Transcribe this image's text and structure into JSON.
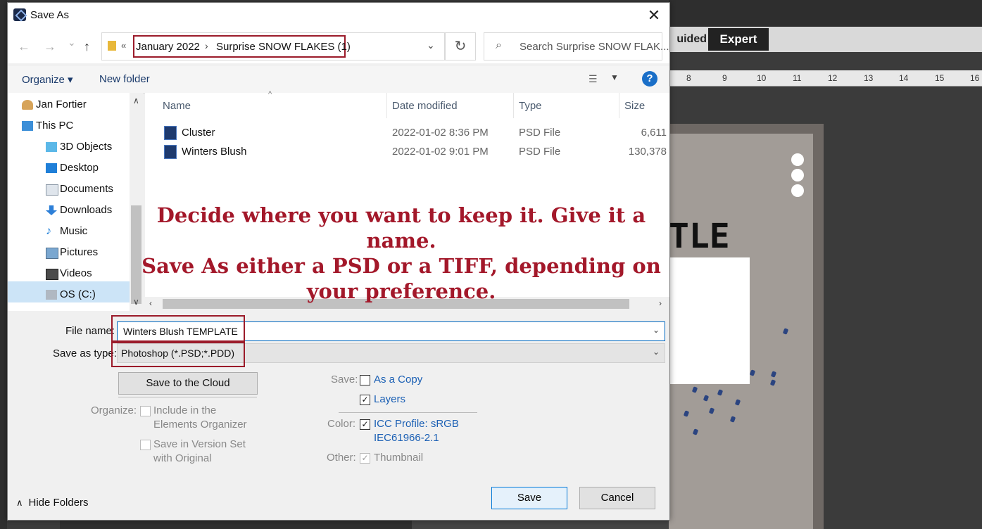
{
  "background_app": {
    "mode_guided": "uided",
    "mode_expert": "Expert",
    "ruler_ticks": [
      "8",
      "9",
      "10",
      "11",
      "12",
      "13",
      "14",
      "15",
      "16"
    ],
    "canvas_title": "TLE"
  },
  "dialog": {
    "title": "Save As",
    "close_symbol": "✕"
  },
  "navigation": {
    "back_symbol": "←",
    "forward_symbol": "→",
    "recent_symbol": "⌄",
    "up_symbol": "↑",
    "chevron": "«",
    "breadcrumb": [
      "January 2022",
      "Surprise SNOW FLAKES (1)"
    ],
    "breadcrumb_sep": "›",
    "refresh_symbol": "↻",
    "search_placeholder": "Search Surprise SNOW FLAK..."
  },
  "toolbar": {
    "organize": "Organize ▾",
    "new_folder": "New folder",
    "help": "?"
  },
  "sidebar": {
    "items": [
      {
        "label": "Jan Fortier",
        "icon": "user-icon"
      },
      {
        "label": "This PC",
        "icon": "computer-icon"
      },
      {
        "label": "3D Objects",
        "icon": "cube-icon"
      },
      {
        "label": "Desktop",
        "icon": "desktop-icon"
      },
      {
        "label": "Documents",
        "icon": "document-icon"
      },
      {
        "label": "Downloads",
        "icon": "download-icon"
      },
      {
        "label": "Music",
        "icon": "music-icon"
      },
      {
        "label": "Pictures",
        "icon": "picture-icon"
      },
      {
        "label": "Videos",
        "icon": "video-icon"
      },
      {
        "label": "OS (C:)",
        "icon": "drive-icon"
      }
    ],
    "selected": "OS (C:)"
  },
  "file_list": {
    "columns": [
      "Name",
      "Date modified",
      "Type",
      "Size"
    ],
    "rows": [
      {
        "name": "Cluster",
        "date": "2022-01-02 8:36 PM",
        "type": "PSD File",
        "size": "6,611"
      },
      {
        "name": "Winters Blush",
        "date": "2022-01-02 9:01 PM",
        "type": "PSD File",
        "size": "130,378"
      }
    ]
  },
  "callout": {
    "line1": "Decide where you want to keep it. Give it a name.",
    "line2": "Save As either a PSD or a TIFF, depending on",
    "line3": "your preference."
  },
  "form": {
    "file_name_label": "File name:",
    "file_name_value": "Winters Blush TEMPLATE",
    "save_as_type_label": "Save as type:",
    "save_as_type_value": "Photoshop (*.PSD;*.PDD)",
    "save_to_cloud": "Save to the Cloud",
    "organize_label": "Organize:",
    "include_organizer_1": "Include in the",
    "include_organizer_2": "Elements Organizer",
    "version_set_1": "Save in Version Set",
    "version_set_2": "with Original",
    "save_label": "Save:",
    "as_copy": "As a Copy",
    "layers": "Layers",
    "color_label": "Color:",
    "icc_profile_1": "ICC Profile:  sRGB",
    "icc_profile_2": "IEC61966-2.1",
    "other_label": "Other:",
    "thumbnail": "Thumbnail",
    "checkbox_checked": "✓",
    "save_button": "Save",
    "cancel_button": "Cancel",
    "hide_folders": "Hide Folders",
    "hide_folders_chevron": "∧"
  }
}
